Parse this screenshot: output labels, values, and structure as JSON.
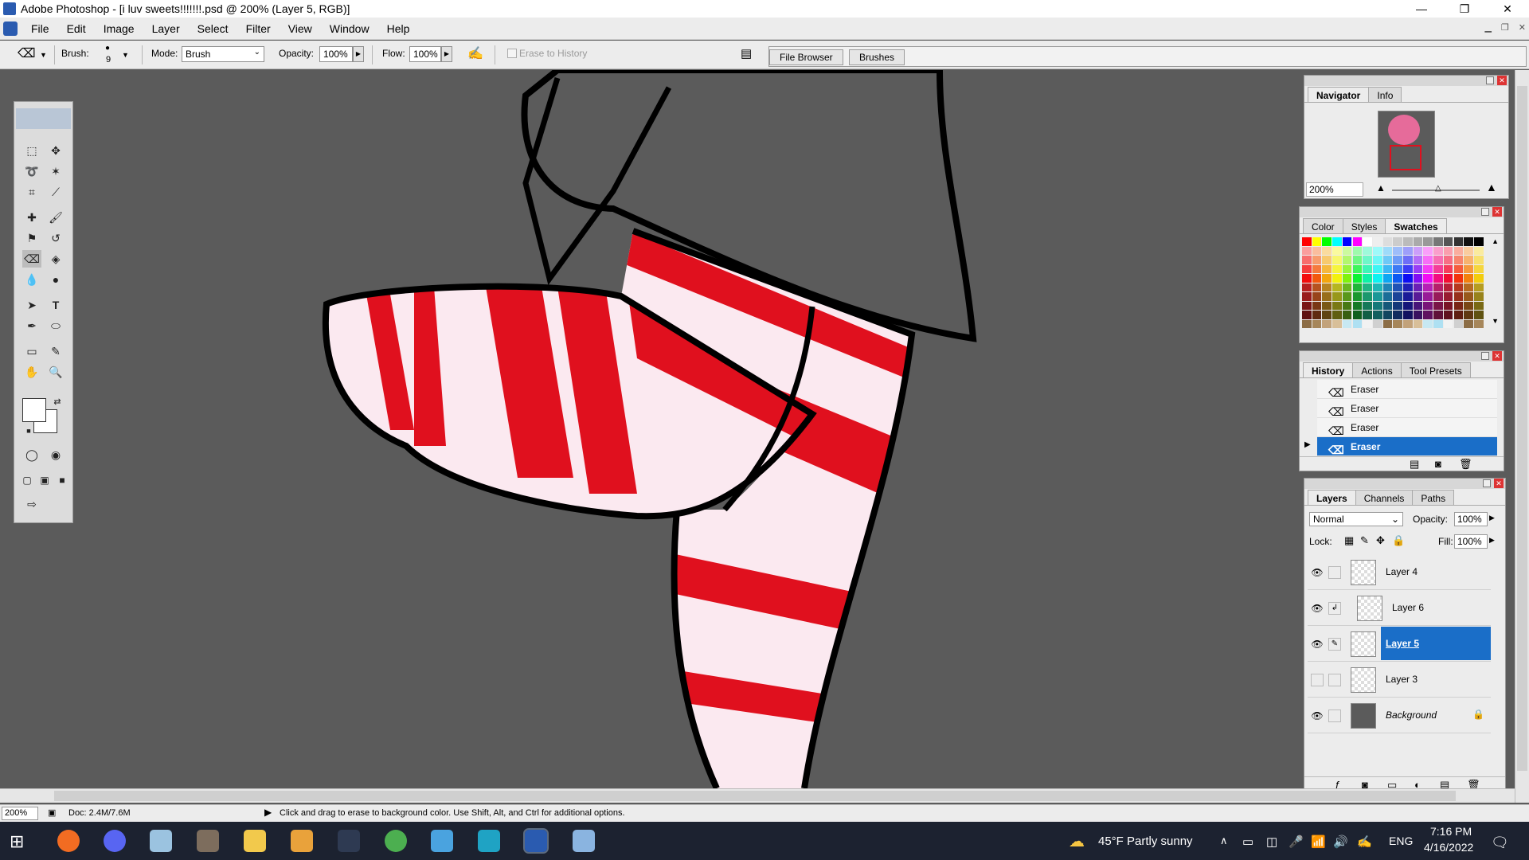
{
  "window": {
    "title": "Adobe Photoshop - [i luv sweets!!!!!!!.psd @ 200% (Layer 5, RGB)]",
    "min": "—",
    "max": "❐",
    "close": "✕"
  },
  "menu": [
    "File",
    "Edit",
    "Image",
    "Layer",
    "Select",
    "Filter",
    "View",
    "Window",
    "Help"
  ],
  "options": {
    "brush_label": "Brush:",
    "brush_size": "9",
    "mode_label": "Mode:",
    "mode_value": "Brush",
    "opacity_label": "Opacity:",
    "opacity_value": "100%",
    "flow_label": "Flow:",
    "flow_value": "100%",
    "erase_history": "Erase to History"
  },
  "wells": {
    "file_browser": "File Browser",
    "brushes": "Brushes"
  },
  "navigator": {
    "tabs": [
      "Navigator",
      "Info"
    ],
    "zoom": "200%"
  },
  "swatches_panel": {
    "tabs": [
      "Color",
      "Styles",
      "Swatches"
    ]
  },
  "history": {
    "tabs": [
      "History",
      "Actions",
      "Tool Presets"
    ],
    "items": [
      "Eraser",
      "Eraser",
      "Eraser",
      "Eraser"
    ],
    "active_index": 3
  },
  "layers": {
    "tabs": [
      "Layers",
      "Channels",
      "Paths"
    ],
    "blend_mode": "Normal",
    "opacity_label": "Opacity:",
    "opacity_value": "100%",
    "lock_label": "Lock:",
    "fill_label": "Fill:",
    "fill_value": "100%",
    "items": [
      {
        "name": "Layer 4",
        "visible": true
      },
      {
        "name": "Layer 6",
        "visible": true
      },
      {
        "name": "Layer 5",
        "visible": true,
        "active": true
      },
      {
        "name": "Layer 3",
        "visible": false
      },
      {
        "name": "Background",
        "visible": true,
        "locked": true
      }
    ]
  },
  "status": {
    "zoom": "200%",
    "doc": "Doc: 2.4M/7.6M",
    "hint": "Click and drag to erase to background color.  Use Shift, Alt, and Ctrl for additional options."
  },
  "taskbar": {
    "weather": "45°F  Partly sunny",
    "lang": "ENG",
    "time": "7:16 PM",
    "date": "4/16/2022"
  },
  "colors": {
    "stripe_red": "#e0101e",
    "canvas_gray": "#5b5b5b",
    "selection_blue": "#1a6ec8"
  }
}
